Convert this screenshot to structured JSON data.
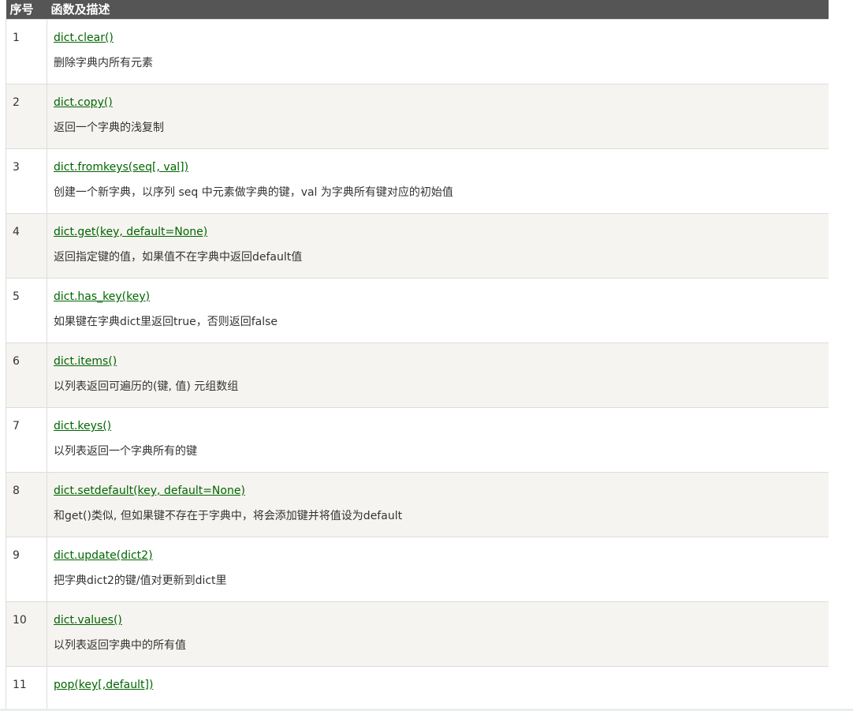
{
  "table": {
    "headers": [
      "序号",
      "函数及描述"
    ],
    "rows": [
      {
        "num": "1",
        "func": "dict.clear()",
        "desc": "删除字典内所有元素"
      },
      {
        "num": "2",
        "func": "dict.copy()",
        "desc": "返回一个字典的浅复制"
      },
      {
        "num": "3",
        "func": "dict.fromkeys(seq[, val])",
        "desc": "创建一个新字典，以序列 seq 中元素做字典的键，val 为字典所有键对应的初始值"
      },
      {
        "num": "4",
        "func": "dict.get(key, default=None)",
        "desc": "返回指定键的值，如果值不在字典中返回default值"
      },
      {
        "num": "5",
        "func": "dict.has_key(key)",
        "desc": "如果键在字典dict里返回true，否则返回false"
      },
      {
        "num": "6",
        "func": "dict.items()",
        "desc": "以列表返回可遍历的(键, 值) 元组数组"
      },
      {
        "num": "7",
        "func": "dict.keys()",
        "desc": "以列表返回一个字典所有的键"
      },
      {
        "num": "8",
        "func": "dict.setdefault(key, default=None)",
        "desc": "和get()类似, 但如果键不存在于字典中，将会添加键并将值设为default"
      },
      {
        "num": "9",
        "func": "dict.update(dict2)",
        "desc": "把字典dict2的键/值对更新到dict里"
      },
      {
        "num": "10",
        "func": "dict.values()",
        "desc": "以列表返回字典中的所有值"
      },
      {
        "num": "11",
        "func": "pop(key[,default])",
        "desc": ""
      }
    ]
  }
}
